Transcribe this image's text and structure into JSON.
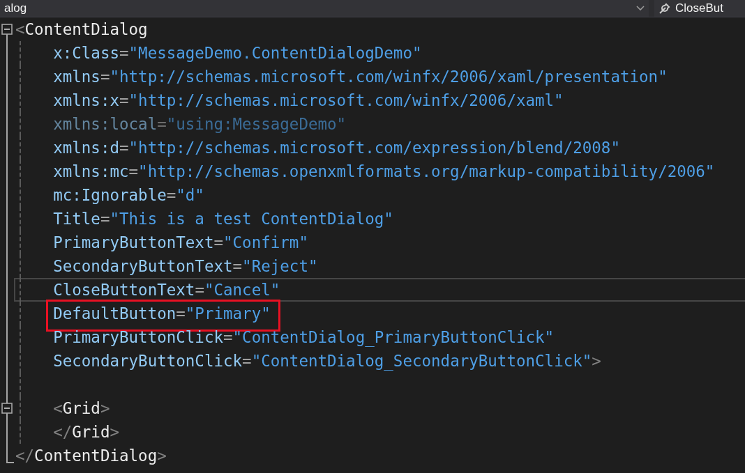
{
  "top_bar": {
    "left_dropdown": "alog",
    "right_dropdown": "CloseBut"
  },
  "lines": [
    {
      "kind": "fold_start",
      "current": false,
      "annotated": false,
      "tokens": [
        {
          "kind": "punct",
          "text": "<"
        },
        {
          "kind": "tag",
          "text": "ContentDialog"
        }
      ],
      "children": [
        {
          "kind": "body",
          "current": false,
          "annotated": false,
          "tokens": [
            {
              "kind": "attr",
              "text": "x:Class"
            },
            {
              "kind": "eq",
              "text": "="
            },
            {
              "kind": "value",
              "text": "\"MessageDemo.ContentDialogDemo\""
            }
          ]
        },
        {
          "kind": "body",
          "current": false,
          "annotated": false,
          "tokens": [
            {
              "kind": "attr",
              "text": "xmlns"
            },
            {
              "kind": "eq",
              "text": "="
            },
            {
              "kind": "value",
              "text": "\"http://schemas.microsoft.com/winfx/2006/xaml/presentation\""
            }
          ]
        },
        {
          "kind": "body",
          "current": false,
          "annotated": false,
          "tokens": [
            {
              "kind": "attr",
              "text": "xmlns:x"
            },
            {
              "kind": "eq",
              "text": "="
            },
            {
              "kind": "value",
              "text": "\"http://schemas.microsoft.com/winfx/2006/xaml\""
            }
          ]
        },
        {
          "kind": "body",
          "current": false,
          "annotated": false,
          "faded": true,
          "tokens": [
            {
              "kind": "attr",
              "text": "xmlns:local"
            },
            {
              "kind": "eq",
              "text": "="
            },
            {
              "kind": "value",
              "text": "\"using:MessageDemo\""
            }
          ]
        },
        {
          "kind": "body",
          "current": false,
          "annotated": false,
          "tokens": [
            {
              "kind": "attr",
              "text": "xmlns:d"
            },
            {
              "kind": "eq",
              "text": "="
            },
            {
              "kind": "value",
              "text": "\"http://schemas.microsoft.com/expression/blend/2008\""
            }
          ]
        },
        {
          "kind": "body",
          "current": false,
          "annotated": false,
          "tokens": [
            {
              "kind": "attr",
              "text": "xmlns:mc"
            },
            {
              "kind": "eq",
              "text": "="
            },
            {
              "kind": "value",
              "text": "\"http://schemas.openxmlformats.org/markup-compatibility/2006\""
            }
          ]
        },
        {
          "kind": "body",
          "current": false,
          "annotated": false,
          "tokens": [
            {
              "kind": "attr",
              "text": "mc:Ignorable"
            },
            {
              "kind": "eq",
              "text": "="
            },
            {
              "kind": "value",
              "text": "\"d\""
            }
          ]
        },
        {
          "kind": "body",
          "current": false,
          "annotated": false,
          "tokens": [
            {
              "kind": "attr",
              "text": "Title"
            },
            {
              "kind": "eq",
              "text": "="
            },
            {
              "kind": "value",
              "text": "\"This is a test ContentDialog\""
            }
          ]
        },
        {
          "kind": "body",
          "current": false,
          "annotated": false,
          "tokens": [
            {
              "kind": "attr",
              "text": "PrimaryButtonText"
            },
            {
              "kind": "eq",
              "text": "="
            },
            {
              "kind": "value",
              "text": "\"Confirm\""
            }
          ]
        },
        {
          "kind": "body",
          "current": false,
          "annotated": false,
          "tokens": [
            {
              "kind": "attr",
              "text": "SecondaryButtonText"
            },
            {
              "kind": "eq",
              "text": "="
            },
            {
              "kind": "value",
              "text": "\"Reject\""
            }
          ]
        },
        {
          "kind": "body",
          "current": true,
          "annotated": false,
          "tokens": [
            {
              "kind": "attr",
              "text": "CloseButtonText"
            },
            {
              "kind": "eq",
              "text": "="
            },
            {
              "kind": "value",
              "text": "\"Cancel\""
            }
          ]
        },
        {
          "kind": "body",
          "current": false,
          "annotated": true,
          "tokens": [
            {
              "kind": "attr",
              "text": "DefaultButton"
            },
            {
              "kind": "eq",
              "text": "="
            },
            {
              "kind": "value",
              "text": "\"Primary\""
            }
          ]
        },
        {
          "kind": "body",
          "current": false,
          "annotated": false,
          "tokens": [
            {
              "kind": "attr",
              "text": "PrimaryButtonClick"
            },
            {
              "kind": "eq",
              "text": "="
            },
            {
              "kind": "value",
              "text": "\"ContentDialog_PrimaryButtonClick\""
            }
          ]
        },
        {
          "kind": "body",
          "current": false,
          "annotated": false,
          "tokens": [
            {
              "kind": "attr",
              "text": "SecondaryButtonClick"
            },
            {
              "kind": "eq",
              "text": "="
            },
            {
              "kind": "value",
              "text": "\"ContentDialog_SecondaryButtonClick\""
            },
            {
              "kind": "punct",
              "text": ">"
            }
          ]
        },
        {
          "kind": "blank",
          "current": false,
          "annotated": false
        },
        {
          "kind": "fold_start",
          "current": false,
          "annotated": false,
          "tokens": [
            {
              "kind": "punct",
              "text": "<"
            },
            {
              "kind": "tag",
              "text": "Grid"
            },
            {
              "kind": "punct",
              "text": ">"
            }
          ]
        },
        {
          "kind": "body",
          "current": false,
          "annotated": false,
          "tokens": [
            {
              "kind": "punct",
              "text": "</"
            },
            {
              "kind": "tag",
              "text": "Grid"
            },
            {
              "kind": "punct",
              "text": ">"
            }
          ]
        }
      ]
    },
    {
      "kind": "fold_end",
      "current": false,
      "annotated": false,
      "tokens": [
        {
          "kind": "punct",
          "text": "</"
        },
        {
          "kind": "tag",
          "text": "ContentDialog"
        },
        {
          "kind": "punct",
          "text": ">"
        }
      ]
    }
  ]
}
